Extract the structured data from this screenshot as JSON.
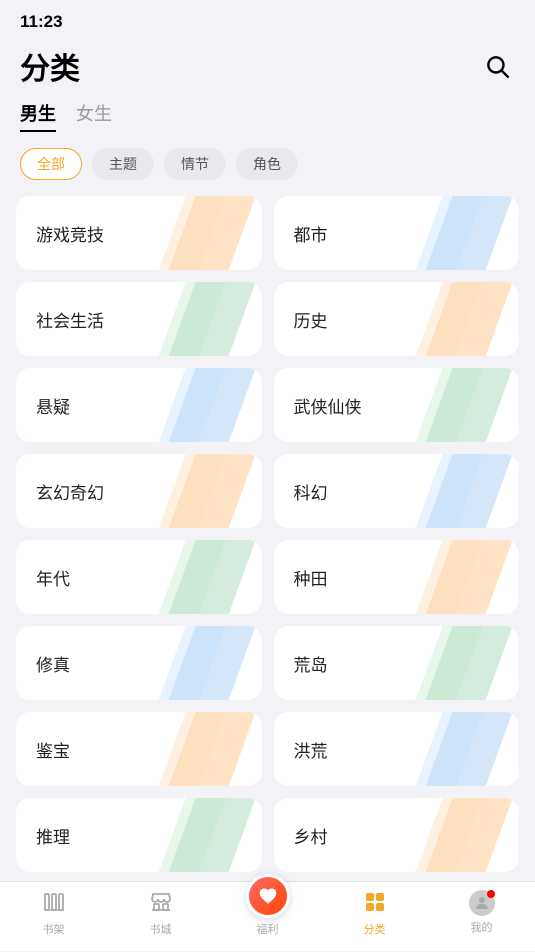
{
  "statusBar": {
    "time": "11:23"
  },
  "header": {
    "title": "分类",
    "searchLabel": "搜索"
  },
  "genderTabs": [
    {
      "id": "male",
      "label": "男生",
      "active": true
    },
    {
      "id": "female",
      "label": "女生",
      "active": false
    }
  ],
  "filterChips": [
    {
      "id": "all",
      "label": "全部",
      "active": true
    },
    {
      "id": "theme",
      "label": "主题",
      "active": false
    },
    {
      "id": "plot",
      "label": "情节",
      "active": false
    },
    {
      "id": "role",
      "label": "角色",
      "active": false
    }
  ],
  "categories": [
    {
      "id": "cat1",
      "label": "游戏竞技",
      "deco": "orange"
    },
    {
      "id": "cat2",
      "label": "都市",
      "deco": "blue"
    },
    {
      "id": "cat3",
      "label": "社会生活",
      "deco": "green"
    },
    {
      "id": "cat4",
      "label": "历史",
      "deco": "orange"
    },
    {
      "id": "cat5",
      "label": "悬疑",
      "deco": "blue"
    },
    {
      "id": "cat6",
      "label": "武侠仙侠",
      "deco": "green"
    },
    {
      "id": "cat7",
      "label": "玄幻奇幻",
      "deco": "orange"
    },
    {
      "id": "cat8",
      "label": "科幻",
      "deco": "blue"
    },
    {
      "id": "cat9",
      "label": "年代",
      "deco": "green"
    },
    {
      "id": "cat10",
      "label": "种田",
      "deco": "orange"
    },
    {
      "id": "cat11",
      "label": "修真",
      "deco": "blue"
    },
    {
      "id": "cat12",
      "label": "荒岛",
      "deco": "green"
    },
    {
      "id": "cat13",
      "label": "鉴宝",
      "deco": "orange"
    },
    {
      "id": "cat14",
      "label": "洪荒",
      "deco": "blue"
    },
    {
      "id": "cat15",
      "label": "推理",
      "deco": "green"
    },
    {
      "id": "cat16",
      "label": "乡村",
      "deco": "orange"
    }
  ],
  "bottomNav": [
    {
      "id": "shelf",
      "label": "书架",
      "icon": "shelf",
      "active": false
    },
    {
      "id": "store",
      "label": "书城",
      "icon": "store",
      "active": false
    },
    {
      "id": "welfare",
      "label": "福利",
      "icon": "gift",
      "active": false
    },
    {
      "id": "category",
      "label": "分类",
      "icon": "category",
      "active": true
    },
    {
      "id": "mine",
      "label": "我的",
      "icon": "person",
      "active": false
    }
  ]
}
